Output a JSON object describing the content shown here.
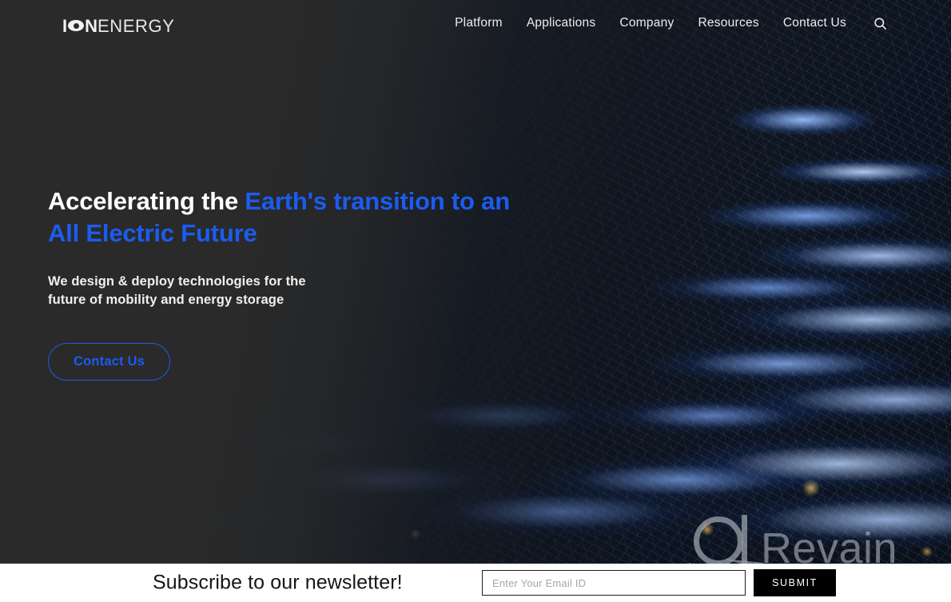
{
  "brand": {
    "logo_prefix": "I",
    "logo_mark_icon": "lens-o-icon",
    "logo_middle": "N",
    "logo_suffix": "ENERGY",
    "accent_color": "#1B5CF0",
    "header_bg": "#2a2a2a"
  },
  "nav": {
    "items": [
      {
        "label": "Platform"
      },
      {
        "label": "Applications"
      },
      {
        "label": "Company"
      },
      {
        "label": "Resources"
      },
      {
        "label": "Contact Us"
      }
    ],
    "search_icon": "search-icon"
  },
  "hero": {
    "headline_white": "Accelerating the ",
    "headline_accent": "Earth's transition to an All Electric Future",
    "subheading": "We design & deploy technologies for the future of mobility and energy storage",
    "cta_label": "Contact Us",
    "background": "aerial-night-city-lights"
  },
  "watermark": {
    "text": "Revain",
    "mark_icon": "revain-ring-icon"
  },
  "newsletter": {
    "title": "Subscribe to our newsletter!",
    "email_placeholder": "Enter Your Email ID",
    "email_value": "",
    "submit_label": "SUBMIT"
  }
}
